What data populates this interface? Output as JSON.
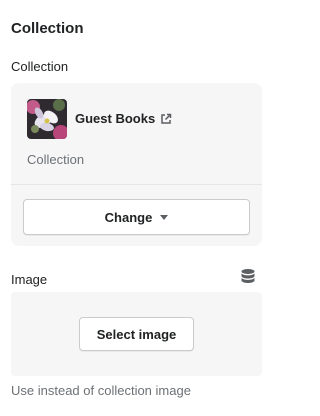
{
  "section": {
    "heading": "Collection"
  },
  "collection_field": {
    "label": "Collection",
    "selected": {
      "title": "Guest Books",
      "type": "Collection",
      "thumbnail_icon": "flowers-thumbnail",
      "link_icon": "external-link-icon"
    },
    "change_label": "Change",
    "change_icon": "caret-down-icon"
  },
  "image_field": {
    "label": "Image",
    "source_icon": "database-icon",
    "select_label": "Select image",
    "help_text": "Use instead of collection image"
  }
}
